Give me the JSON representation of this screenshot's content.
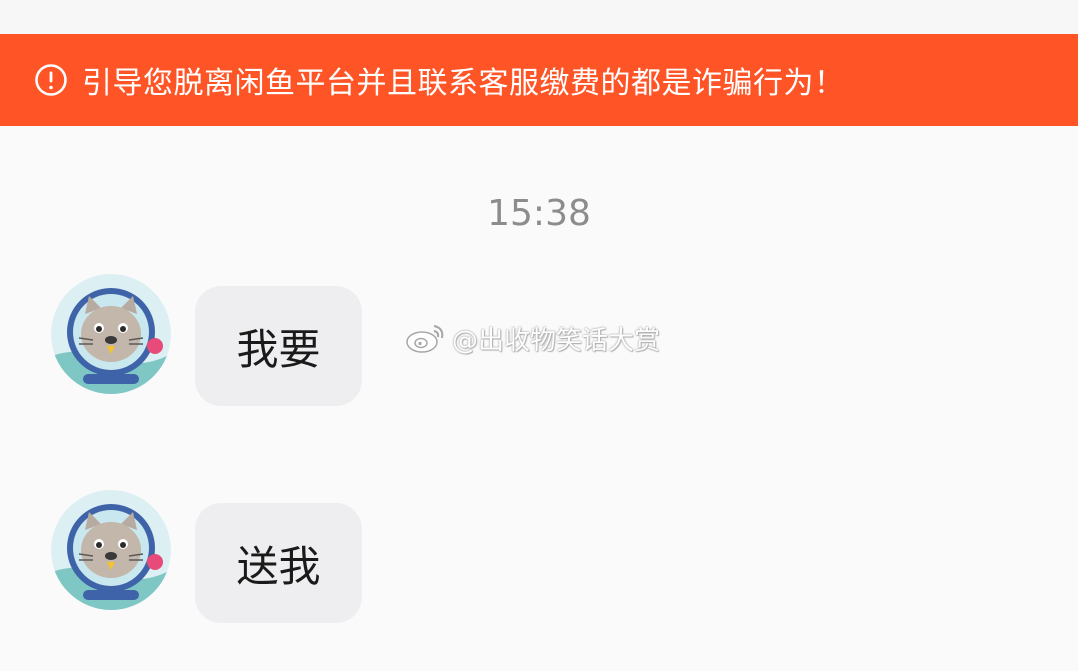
{
  "banner": {
    "icon": "info-circle-icon",
    "text": "引导您脱离闲鱼平台并且联系客服缴费的都是诈骗行为！",
    "color": "#ff5426"
  },
  "chat": {
    "timestamp": "15:38",
    "messages": [
      {
        "sender_avatar": "astronaut-cat-avatar",
        "text": "我要"
      },
      {
        "sender_avatar": "astronaut-cat-avatar",
        "text": "送我"
      }
    ]
  },
  "watermark": {
    "logo": "weibo-logo-icon",
    "text": "@出收物笑话大赏"
  }
}
